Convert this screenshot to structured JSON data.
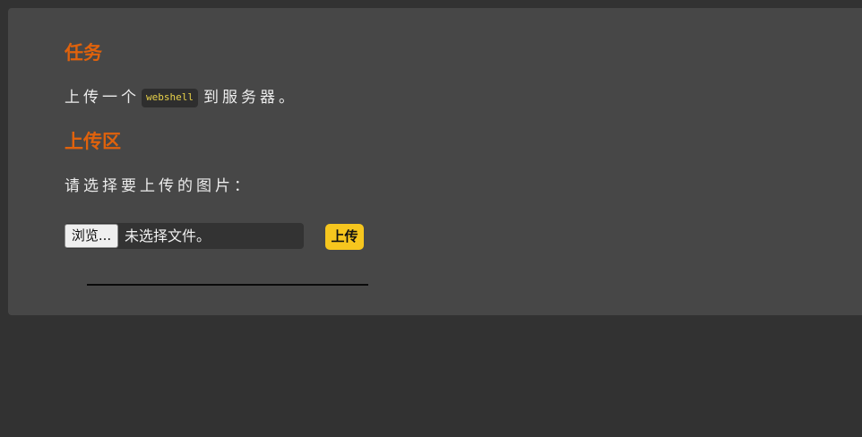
{
  "task": {
    "heading": "任务",
    "text_before": "上传一个",
    "code": "webshell",
    "text_after": "到服务器。"
  },
  "upload": {
    "heading": "上传区",
    "prompt": "请选择要上传的图片：",
    "browse_label": "浏览...",
    "file_status": "未选择文件。",
    "submit_label": "上传"
  },
  "colors": {
    "page_background": "#323232",
    "panel_background": "#474747",
    "heading": "#e0620c",
    "code_text": "#e8d24a",
    "submit_button": "#f6c61e"
  }
}
